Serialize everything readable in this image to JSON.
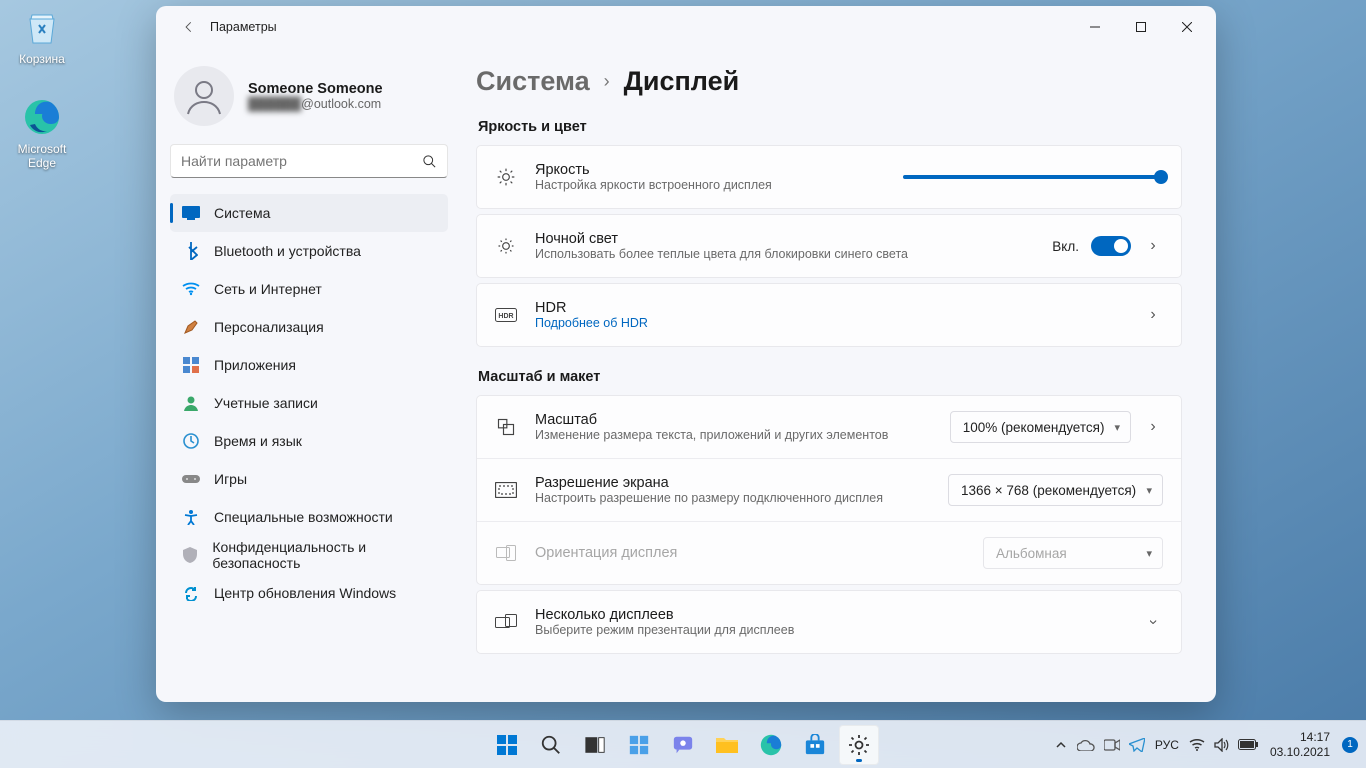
{
  "desktop": {
    "recycle_bin": "Корзина",
    "edge": "Microsoft\nEdge"
  },
  "window": {
    "title": "Параметры",
    "profile": {
      "name": "Someone Someone",
      "email_suffix": "@outlook.com",
      "email_prefix_masked": "██████"
    },
    "search_placeholder": "Найти параметр",
    "nav": {
      "system": "Система",
      "bluetooth": "Bluetooth и устройства",
      "network": "Сеть и Интернет",
      "personalization": "Персонализация",
      "apps": "Приложения",
      "accounts": "Учетные записи",
      "time_lang": "Время и язык",
      "games": "Игры",
      "accessibility": "Специальные возможности",
      "privacy": "Конфиденциальность и безопасность",
      "update": "Центр обновления Windows"
    },
    "breadcrumb": {
      "parent": "Система",
      "current": "Дисплей"
    },
    "sections": {
      "brightness_color": "Яркость и цвет",
      "scale_layout": "Масштаб и макет"
    },
    "rows": {
      "brightness": {
        "title": "Яркость",
        "sub": "Настройка яркости встроенного дисплея"
      },
      "nightlight": {
        "title": "Ночной свет",
        "sub": "Использовать более теплые цвета для блокировки синего света",
        "toggle_label": "Вкл."
      },
      "hdr": {
        "title": "HDR",
        "sub": "Подробнее об HDR"
      },
      "scale": {
        "title": "Масштаб",
        "sub": "Изменение размера текста, приложений и других элементов",
        "value": "100% (рекомендуется)"
      },
      "resolution": {
        "title": "Разрешение экрана",
        "sub": "Настроить разрешение по размеру подключенного дисплея",
        "value": "1366 × 768 (рекомендуется)"
      },
      "orientation": {
        "title": "Ориентация дисплея",
        "value": "Альбомная"
      },
      "multi": {
        "title": "Несколько дисплеев",
        "sub": "Выберите режим презентации для дисплеев"
      }
    }
  },
  "tray": {
    "lang": "РУС",
    "time": "14:17",
    "date": "03.10.2021",
    "badge": "1"
  }
}
